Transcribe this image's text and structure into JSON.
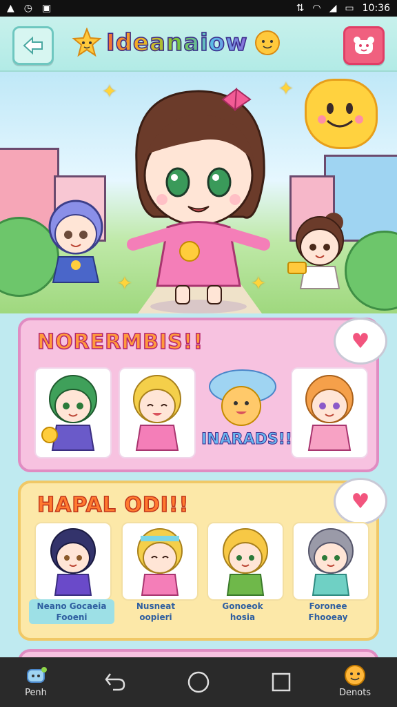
{
  "status_bar": {
    "time": "10:36"
  },
  "header": {
    "title": "Ideanaiow"
  },
  "hero": {
    "label": "hero-scene"
  },
  "panel_pink": {
    "title": "NORERMBIS!!",
    "banner": "INARADS!!"
  },
  "panel_yellow": {
    "title": "HAPAL ODI!!",
    "captions": [
      {
        "line1": "Neano Gocaeia",
        "line2": "Fooeni"
      },
      {
        "line1": "Nusneat",
        "line2": "oopieri"
      },
      {
        "line1": "Gonoeok",
        "line2": "hosia"
      },
      {
        "line1": "Foronee",
        "line2": "Fhooeay"
      }
    ]
  },
  "navbar": {
    "left_label": "Penh",
    "right_label": "Denots"
  },
  "colors": {
    "accent_pink": "#f0607f",
    "teal": "#6ec7c0",
    "yellow": "#ffd23f"
  }
}
